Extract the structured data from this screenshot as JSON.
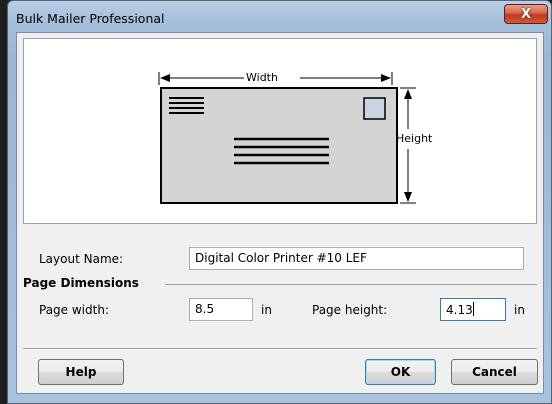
{
  "window": {
    "title": "Bulk Mailer Professional",
    "close_glyph": "X"
  },
  "preview": {
    "width_label": "Width",
    "height_label": "Height",
    "icons": [
      "envelope-diagram-icon",
      "stamp-icon",
      "return-address-lines-icon",
      "recipient-address-lines-icon"
    ]
  },
  "form": {
    "layout_name_label": "Layout Name:",
    "layout_name_value": "Digital Color Printer #10 LEF",
    "section_title": "Page Dimensions",
    "page_width_label": "Page width:",
    "page_width_value": "8.5",
    "page_width_unit": "in",
    "page_height_label": "Page height:",
    "page_height_value": "4.13",
    "page_height_unit": "in"
  },
  "buttons": {
    "help": "Help",
    "ok": "OK",
    "cancel": "Cancel"
  },
  "colors": {
    "title_bar": "#a6c0dc",
    "close_button": "#c1391e",
    "dialog_background": "#f0f0f0",
    "envelope_fill": "#d4d4d4",
    "stamp_fill": "#c8d4e2"
  }
}
